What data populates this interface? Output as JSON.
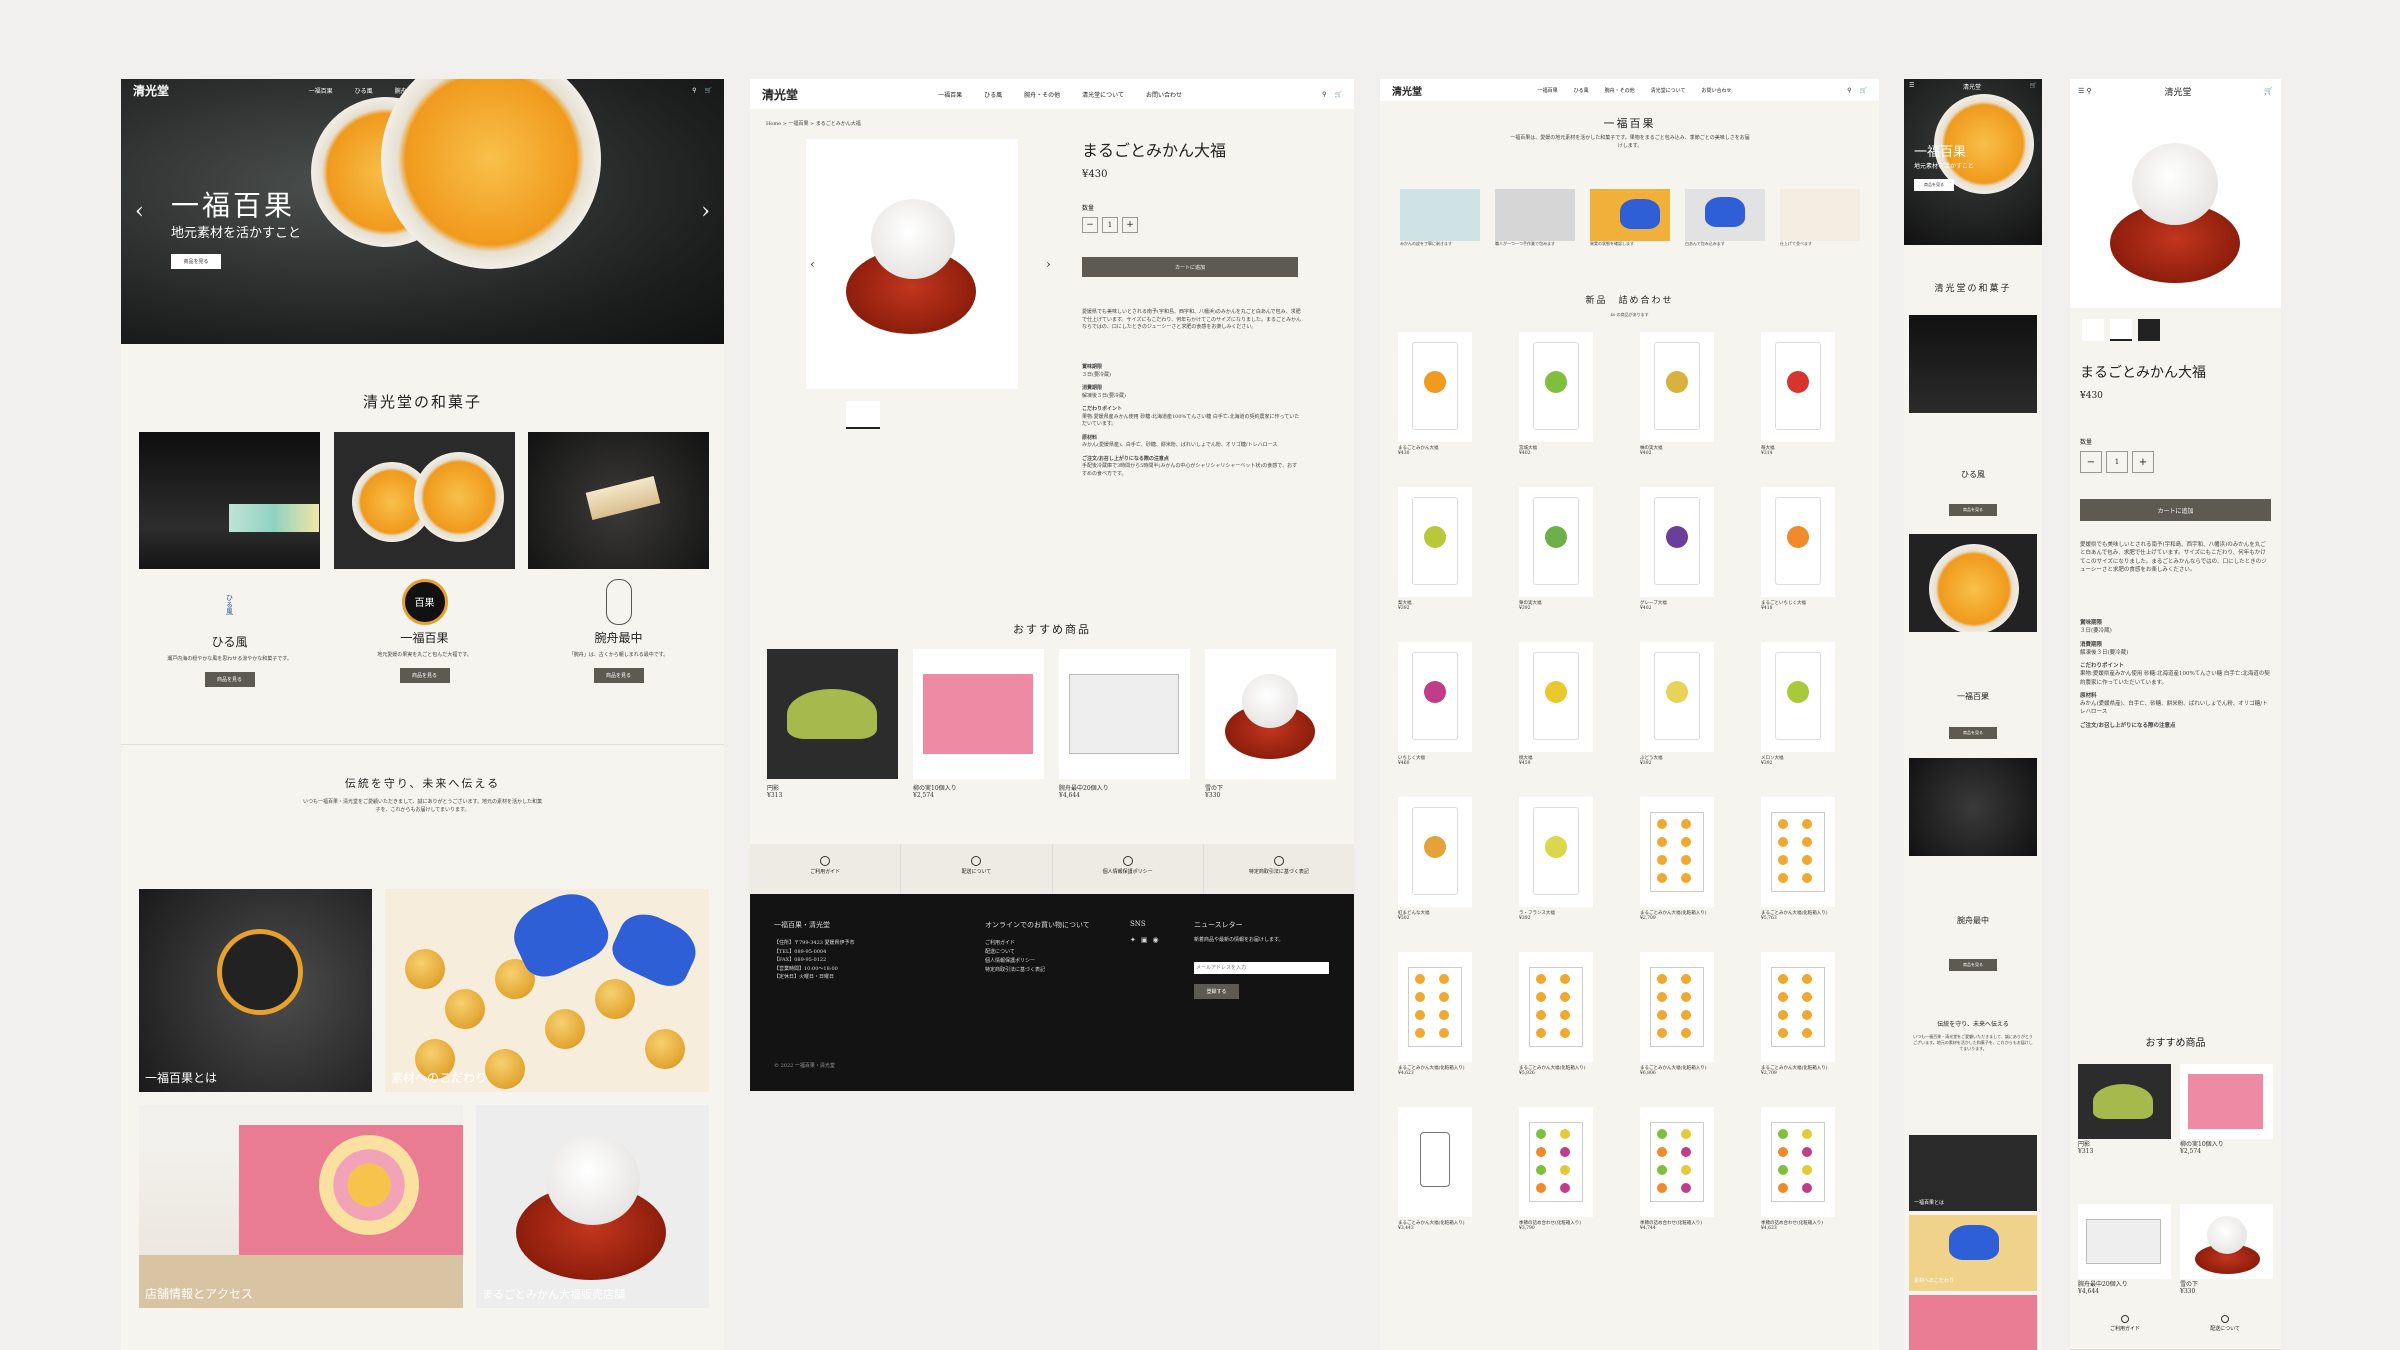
{
  "brand": "清光堂",
  "nav": [
    "一福百果",
    "ひる風",
    "腕舟・その他",
    "清光堂について",
    "お問い合わせ"
  ],
  "nav_right": {
    "search": "検索",
    "cart": "カート"
  },
  "hero": {
    "title": "一福百果",
    "subtitle": "地元素材を活かすこと",
    "button": "商品を見る"
  },
  "section_title": "清光堂の和菓子",
  "products_home": [
    {
      "name": "ひる風",
      "desc": "瀬戸内海の穏やかな風を思わせる涼やかな和菓子です。",
      "button": "商品を見る"
    },
    {
      "name": "一福百果",
      "desc": "地元愛媛の果実を丸ごと包んだ大福です。",
      "button": "商品を見る"
    },
    {
      "name": "腕舟最中",
      "desc": "「腕舟」は、古くから親しまれる最中です。",
      "button": "商品を見る"
    }
  ],
  "tradition": {
    "title": "伝統を守り、未来へ伝える",
    "text": "いつも一福百果・清光堂をご愛顧いただきまして、誠にありがとうございます。地元の素材を活かした和菓子を、これからもお届けしてまいります。"
  },
  "tiles": [
    "一福百果とは",
    "素材へのこだわり",
    "店舗情報とアクセス",
    "まるごとみかん大福販売店舗"
  ],
  "product": {
    "breadcrumb": "Home > 一福百果 > まるごとみかん大福",
    "name": "まるごとみかん大福",
    "price": "¥430",
    "qty_label": "数量",
    "qty": "1",
    "add_to_cart": "カートに追加",
    "desc": "愛媛県でも美味しいとされる南予(宇和島、西宇和、八幡浜)のみかんを丸ごと白あんで包み、求肥で仕上げています。サイズにもこだわり、何年もかけてこのサイズになりました。まるごとみかんならではの、口にしたときのジューシーさと求肥の食感をお楽しみください。",
    "specs": [
      {
        "h": "賞味期限",
        "t": "３日(要冷蔵)"
      },
      {
        "h": "消費期限",
        "t": "解凍後３日(要冷蔵)"
      },
      {
        "h": "こだわりポイント",
        "t": "果物:愛媛県産みかん使用 砂糖:北海道産100%てんさい糖 白手亡:北海道の契約農家に作っていただいています。"
      },
      {
        "h": "原材料",
        "t": "みかん(愛媛県産)、白手亡、砂糖、餅米粉、ばれいしょでん粉、オリゴ糖/トレハロース"
      },
      {
        "h": "ご注文/お召し上がりになる際の注意点",
        "t": "手配後冷蔵庫で3時間から5時間半(みかんの中心がシャリシャリシャーベット状)の食感で、おすすめの食べ方です。"
      }
    ]
  },
  "recommend": {
    "title": "おすすめ商品",
    "items": [
      {
        "name": "円影",
        "price": "¥313"
      },
      {
        "name": "柳の実10個入り",
        "price": "¥2,574"
      },
      {
        "name": "腕舟最中20個入り",
        "price": "¥4,644"
      },
      {
        "name": "雪の下",
        "price": "¥330"
      }
    ]
  },
  "footer_icons": [
    "ご利用ガイド",
    "配送について",
    "個人情報保護ポリシー",
    "特定商取引法に基づく表記"
  ],
  "footer": {
    "company": "一福百果・清光堂",
    "info": [
      "【住所】〒799-3423 愛媛県伊予市",
      "【TEL】089-95-0004",
      "【FAX】089-95-0122",
      "【営業時間】10:00〜18:00",
      "【定休日】火曜日・日曜日"
    ],
    "online_title": "オンラインでのお買い物について",
    "online_links": [
      "ご利用ガイド",
      "配送について",
      "個人情報保護ポリシー",
      "特定商取引法に基づく表記"
    ],
    "sns": "SNS",
    "newsletter": "ニュースレター",
    "newsletter_text": "新着商品や最新の情報をお届けします。",
    "email_placeholder": "メールアドレスを入力",
    "subscribe": "登録する",
    "copyright": "© 2022 一福百果・清光堂"
  },
  "catalog": {
    "title": "一福百果",
    "intro": "一福百果は、愛媛の地元素材を活かした和菓子です。果物をまるごと包み込み、季節ごとの美味しさをお届けします。",
    "steps": [
      "みかんの皮を丁寧に剥きます",
      "職人が一つ一つ手作業で包みます",
      "果実の状態を確認します",
      "白あんで包み込みます",
      "仕上げて並べます"
    ],
    "list_title": "新品　詰め合わせ",
    "count": "40 の商品があります",
    "items": [
      {
        "name": "まるごとみかん大福",
        "price": "¥430",
        "c": "#f29a1e"
      },
      {
        "name": "宮城大福",
        "price": "¥402",
        "c": "#7fbf3e"
      },
      {
        "name": "柚の実大福",
        "price": "¥402",
        "c": "#d8b23c"
      },
      {
        "name": "苺大福",
        "price": "¥314",
        "c": "#d8342e"
      },
      {
        "name": "梨大福",
        "price": "¥392",
        "c": "#b9c83a"
      },
      {
        "name": "栗の実大福",
        "price": "¥392",
        "c": "#6db04a"
      },
      {
        "name": "グレープ大福",
        "price": "¥402",
        "c": "#6a3f9a"
      },
      {
        "name": "まるごといちじく大福",
        "price": "¥418",
        "c": "#f08a2a"
      },
      {
        "name": "いちじく大福",
        "price": "¥460",
        "c": "#c03d8a"
      },
      {
        "name": "桃大福",
        "price": "¥459",
        "c": "#e9c92e"
      },
      {
        "name": "ぶどう大福",
        "price": "¥392",
        "c": "#e7d35a"
      },
      {
        "name": "メロン大福",
        "price": "¥392",
        "c": "#a8c93a"
      },
      {
        "name": "紅まどんな大福",
        "price": "¥502",
        "c": "#e6a23a"
      },
      {
        "name": "ラ・フランス大福",
        "price": "¥392",
        "c": "#dcd64a"
      },
      {
        "name": "まるごとみかん大福(化粧箱入り)",
        "price": "¥2,709",
        "c": "box"
      },
      {
        "name": "まるごとみかん大福(化粧箱入り)",
        "price": "¥5,763",
        "c": "box"
      },
      {
        "name": "まるごとみかん大福(化粧箱入り)",
        "price": "¥4,623",
        "c": "box"
      },
      {
        "name": "まるごとみかん大福(化粧箱入り)",
        "price": "¥5,926",
        "c": "box"
      },
      {
        "name": "まるごとみかん大福(化粧箱入り)",
        "price": "¥6,806",
        "c": "box"
      },
      {
        "name": "まるごとみかん大福(化粧箱入り)",
        "price": "¥2,709",
        "c": "box"
      },
      {
        "name": "まるごとみかん大福(化粧箱入り)",
        "price": "¥3,443",
        "c": "line"
      },
      {
        "name": "季節の詰め合わせ(化粧箱入り)",
        "price": "¥3,790",
        "c": "mix"
      },
      {
        "name": "季節の詰め合わせ(化粧箱入り)",
        "price": "¥4,744",
        "c": "mix"
      },
      {
        "name": "季節の詰め合わせ(化粧箱入り)",
        "price": "¥4,623",
        "c": "mix"
      }
    ]
  },
  "mobile": {
    "menu": "メニュー",
    "recommend": "おすすめ商品",
    "guide": "ご利用ガイド",
    "shipping": "配送について"
  }
}
